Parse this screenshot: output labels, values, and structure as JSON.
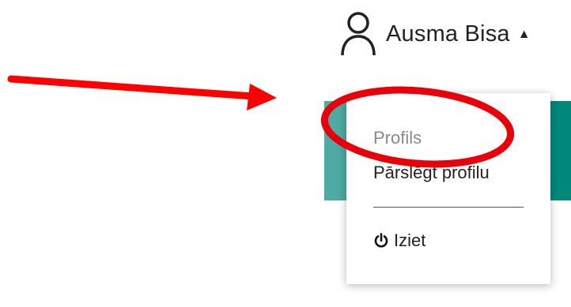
{
  "user": {
    "name": "Ausma Bisa",
    "avatar_icon": "user-outline-icon",
    "caret_icon": "caret-up-icon",
    "caret_glyph": "▲"
  },
  "menu": {
    "items": [
      {
        "label": "Profils",
        "state": "disabled"
      },
      {
        "label": "Pārslēgt profilu",
        "state": "enabled"
      }
    ],
    "logout": {
      "label": "Iziet",
      "icon": "power-icon"
    }
  },
  "annotation": {
    "arrow_color": "#ff0000",
    "ellipse_color": "#e8000b"
  },
  "colors": {
    "teal": "#00897b",
    "teal_light": "#4eaaa2",
    "text": "#222222",
    "muted": "#8a8a8a"
  }
}
